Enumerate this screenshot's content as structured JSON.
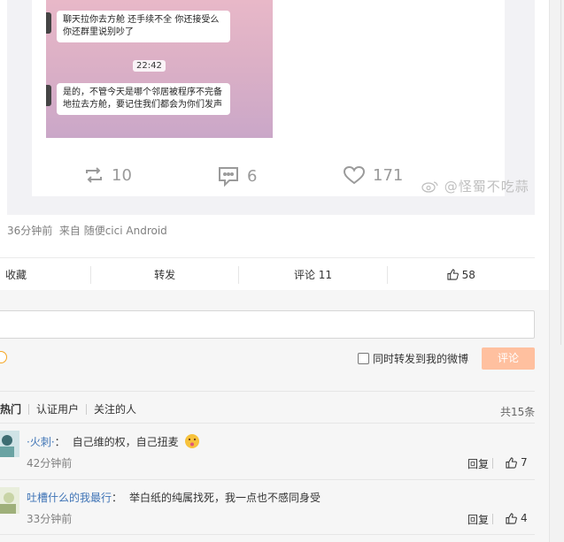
{
  "chat_screenshot": {
    "bubble1": "聊天拉你去方舱 还手续不全 你还接受么 你还群里说别吵了",
    "time": "22:42",
    "bubble2": "是的，不管今天是哪个邻居被程序不完备地拉去方舱，要记住我们都会为你们发声"
  },
  "repost_stats": {
    "reposts": "10",
    "comments": "6",
    "likes": "171"
  },
  "watermark": "@怪蜀不吃蒜",
  "post_meta": "36分钟前  来自 随便cici Android",
  "actions": {
    "favorite": "收藏",
    "forward": "转发",
    "comment": "评论 11",
    "like": "58"
  },
  "composer": {
    "input_placeholder": "",
    "forward_option": "同时转发到我的微博",
    "submit": "评论"
  },
  "comment_filters": {
    "hot": "热门",
    "verified": "认证用户",
    "following": "关注的人",
    "total": "共15条"
  },
  "comments": [
    {
      "user": "·火刺·",
      "sep": "：",
      "text": "自己维的权，自己扭麦",
      "emoji": "face-with-kiss-emoji",
      "time": "42分钟前",
      "reply": "回复",
      "likes": "7"
    },
    {
      "user": "吐槽什么的我最行",
      "sep": "：",
      "text": "举白纸的纯属找死，我一点也不感同身受",
      "time": "33分钟前",
      "reply": "回复",
      "likes": "4"
    }
  ],
  "colors": {
    "accent_orange": "#ffc09f",
    "link_blue": "#3f74b6"
  }
}
